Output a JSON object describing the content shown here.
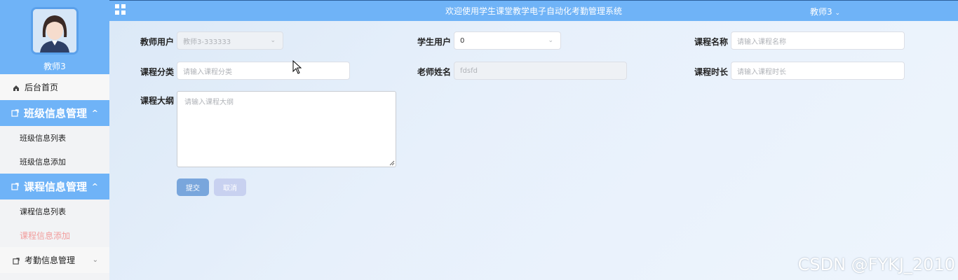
{
  "header": {
    "title": "欢迎使用学生课堂教学电子自动化考勤管理系统",
    "user": "教师3"
  },
  "sidebar": {
    "profile_name": "教师3",
    "home": "后台首页",
    "groups": [
      {
        "label": "班级信息管理",
        "items": [
          "班级信息列表",
          "班级信息添加"
        ]
      },
      {
        "label": "课程信息管理",
        "items": [
          "课程信息列表",
          "课程信息添加"
        ]
      }
    ],
    "collapsed_item": "考勤信息管理"
  },
  "form": {
    "teacher_user_label": "教师用户",
    "teacher_user_value": "教师3-333333",
    "student_user_label": "学生用户",
    "student_user_value": "0",
    "course_name_label": "课程名称",
    "course_name_placeholder": "请输入课程名称",
    "course_category_label": "课程分类",
    "course_category_placeholder": "请输入课程分类",
    "teacher_name_label": "老师姓名",
    "teacher_name_value": "fdsfd",
    "course_duration_label": "课程时长",
    "course_duration_placeholder": "请输入课程时长",
    "syllabus_label": "课程大纲",
    "syllabus_placeholder": "请输入课程大纲",
    "submit_label": "提交",
    "cancel_label": "取消"
  },
  "watermark": "CSDN @FYKJ_2010",
  "colors": {
    "accent": "#6fb3f7",
    "active_menu": "#f29c9c",
    "submit": "#79a6dc",
    "cancel": "#c8d1f0"
  }
}
